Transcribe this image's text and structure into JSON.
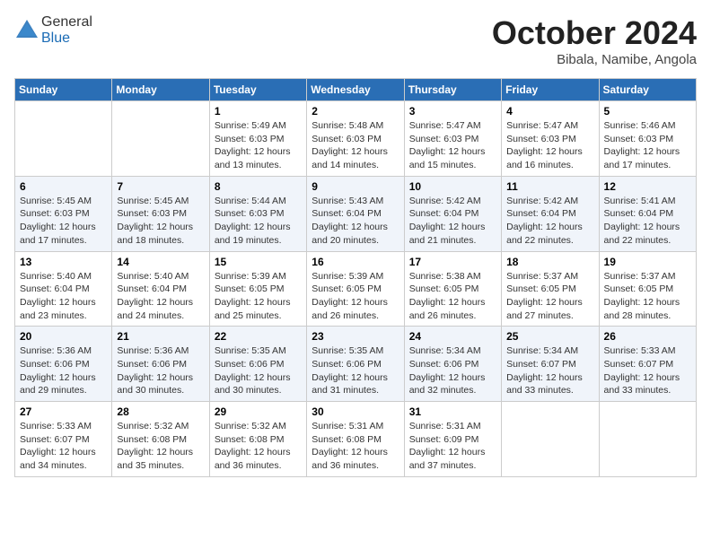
{
  "logo": {
    "general": "General",
    "blue": "Blue"
  },
  "header": {
    "month": "October 2024",
    "location": "Bibala, Namibe, Angola"
  },
  "weekdays": [
    "Sunday",
    "Monday",
    "Tuesday",
    "Wednesday",
    "Thursday",
    "Friday",
    "Saturday"
  ],
  "weeks": [
    [
      {
        "day": "",
        "sunrise": "",
        "sunset": "",
        "daylight": ""
      },
      {
        "day": "",
        "sunrise": "",
        "sunset": "",
        "daylight": ""
      },
      {
        "day": "1",
        "sunrise": "Sunrise: 5:49 AM",
        "sunset": "Sunset: 6:03 PM",
        "daylight": "Daylight: 12 hours and 13 minutes."
      },
      {
        "day": "2",
        "sunrise": "Sunrise: 5:48 AM",
        "sunset": "Sunset: 6:03 PM",
        "daylight": "Daylight: 12 hours and 14 minutes."
      },
      {
        "day": "3",
        "sunrise": "Sunrise: 5:47 AM",
        "sunset": "Sunset: 6:03 PM",
        "daylight": "Daylight: 12 hours and 15 minutes."
      },
      {
        "day": "4",
        "sunrise": "Sunrise: 5:47 AM",
        "sunset": "Sunset: 6:03 PM",
        "daylight": "Daylight: 12 hours and 16 minutes."
      },
      {
        "day": "5",
        "sunrise": "Sunrise: 5:46 AM",
        "sunset": "Sunset: 6:03 PM",
        "daylight": "Daylight: 12 hours and 17 minutes."
      }
    ],
    [
      {
        "day": "6",
        "sunrise": "Sunrise: 5:45 AM",
        "sunset": "Sunset: 6:03 PM",
        "daylight": "Daylight: 12 hours and 17 minutes."
      },
      {
        "day": "7",
        "sunrise": "Sunrise: 5:45 AM",
        "sunset": "Sunset: 6:03 PM",
        "daylight": "Daylight: 12 hours and 18 minutes."
      },
      {
        "day": "8",
        "sunrise": "Sunrise: 5:44 AM",
        "sunset": "Sunset: 6:03 PM",
        "daylight": "Daylight: 12 hours and 19 minutes."
      },
      {
        "day": "9",
        "sunrise": "Sunrise: 5:43 AM",
        "sunset": "Sunset: 6:04 PM",
        "daylight": "Daylight: 12 hours and 20 minutes."
      },
      {
        "day": "10",
        "sunrise": "Sunrise: 5:42 AM",
        "sunset": "Sunset: 6:04 PM",
        "daylight": "Daylight: 12 hours and 21 minutes."
      },
      {
        "day": "11",
        "sunrise": "Sunrise: 5:42 AM",
        "sunset": "Sunset: 6:04 PM",
        "daylight": "Daylight: 12 hours and 22 minutes."
      },
      {
        "day": "12",
        "sunrise": "Sunrise: 5:41 AM",
        "sunset": "Sunset: 6:04 PM",
        "daylight": "Daylight: 12 hours and 22 minutes."
      }
    ],
    [
      {
        "day": "13",
        "sunrise": "Sunrise: 5:40 AM",
        "sunset": "Sunset: 6:04 PM",
        "daylight": "Daylight: 12 hours and 23 minutes."
      },
      {
        "day": "14",
        "sunrise": "Sunrise: 5:40 AM",
        "sunset": "Sunset: 6:04 PM",
        "daylight": "Daylight: 12 hours and 24 minutes."
      },
      {
        "day": "15",
        "sunrise": "Sunrise: 5:39 AM",
        "sunset": "Sunset: 6:05 PM",
        "daylight": "Daylight: 12 hours and 25 minutes."
      },
      {
        "day": "16",
        "sunrise": "Sunrise: 5:39 AM",
        "sunset": "Sunset: 6:05 PM",
        "daylight": "Daylight: 12 hours and 26 minutes."
      },
      {
        "day": "17",
        "sunrise": "Sunrise: 5:38 AM",
        "sunset": "Sunset: 6:05 PM",
        "daylight": "Daylight: 12 hours and 26 minutes."
      },
      {
        "day": "18",
        "sunrise": "Sunrise: 5:37 AM",
        "sunset": "Sunset: 6:05 PM",
        "daylight": "Daylight: 12 hours and 27 minutes."
      },
      {
        "day": "19",
        "sunrise": "Sunrise: 5:37 AM",
        "sunset": "Sunset: 6:05 PM",
        "daylight": "Daylight: 12 hours and 28 minutes."
      }
    ],
    [
      {
        "day": "20",
        "sunrise": "Sunrise: 5:36 AM",
        "sunset": "Sunset: 6:06 PM",
        "daylight": "Daylight: 12 hours and 29 minutes."
      },
      {
        "day": "21",
        "sunrise": "Sunrise: 5:36 AM",
        "sunset": "Sunset: 6:06 PM",
        "daylight": "Daylight: 12 hours and 30 minutes."
      },
      {
        "day": "22",
        "sunrise": "Sunrise: 5:35 AM",
        "sunset": "Sunset: 6:06 PM",
        "daylight": "Daylight: 12 hours and 30 minutes."
      },
      {
        "day": "23",
        "sunrise": "Sunrise: 5:35 AM",
        "sunset": "Sunset: 6:06 PM",
        "daylight": "Daylight: 12 hours and 31 minutes."
      },
      {
        "day": "24",
        "sunrise": "Sunrise: 5:34 AM",
        "sunset": "Sunset: 6:06 PM",
        "daylight": "Daylight: 12 hours and 32 minutes."
      },
      {
        "day": "25",
        "sunrise": "Sunrise: 5:34 AM",
        "sunset": "Sunset: 6:07 PM",
        "daylight": "Daylight: 12 hours and 33 minutes."
      },
      {
        "day": "26",
        "sunrise": "Sunrise: 5:33 AM",
        "sunset": "Sunset: 6:07 PM",
        "daylight": "Daylight: 12 hours and 33 minutes."
      }
    ],
    [
      {
        "day": "27",
        "sunrise": "Sunrise: 5:33 AM",
        "sunset": "Sunset: 6:07 PM",
        "daylight": "Daylight: 12 hours and 34 minutes."
      },
      {
        "day": "28",
        "sunrise": "Sunrise: 5:32 AM",
        "sunset": "Sunset: 6:08 PM",
        "daylight": "Daylight: 12 hours and 35 minutes."
      },
      {
        "day": "29",
        "sunrise": "Sunrise: 5:32 AM",
        "sunset": "Sunset: 6:08 PM",
        "daylight": "Daylight: 12 hours and 36 minutes."
      },
      {
        "day": "30",
        "sunrise": "Sunrise: 5:31 AM",
        "sunset": "Sunset: 6:08 PM",
        "daylight": "Daylight: 12 hours and 36 minutes."
      },
      {
        "day": "31",
        "sunrise": "Sunrise: 5:31 AM",
        "sunset": "Sunset: 6:09 PM",
        "daylight": "Daylight: 12 hours and 37 minutes."
      },
      {
        "day": "",
        "sunrise": "",
        "sunset": "",
        "daylight": ""
      },
      {
        "day": "",
        "sunrise": "",
        "sunset": "",
        "daylight": ""
      }
    ]
  ]
}
